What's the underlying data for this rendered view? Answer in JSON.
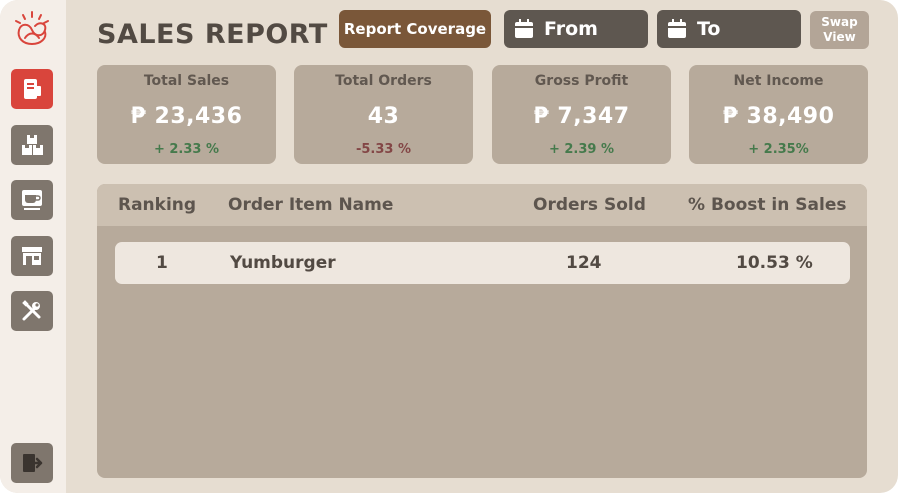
{
  "header": {
    "title": "SALES REPORT",
    "report_coverage_label": "Report Coverage",
    "from_label": "From",
    "to_label": "To",
    "swap_view_line1": "Swap",
    "swap_view_line2": "View"
  },
  "sidebar": {
    "items": [
      {
        "icon": "receipt-icon",
        "active": true
      },
      {
        "icon": "boxes-icon",
        "active": false
      },
      {
        "icon": "coffee-cup-icon",
        "active": false
      },
      {
        "icon": "store-icon",
        "active": false
      },
      {
        "icon": "tools-icon",
        "active": false
      }
    ],
    "logout_icon": "logout-icon",
    "logo_icon": "pretzel-logo-icon"
  },
  "stats": [
    {
      "label": "Total Sales",
      "value": "₱ 23,436",
      "change": "+ 2.33 %",
      "trend": "positive"
    },
    {
      "label": "Total Orders",
      "value": "43",
      "change": "-5.33 %",
      "trend": "negative"
    },
    {
      "label": "Gross Profit",
      "value": "₱ 7,347",
      "change": "+ 2.39 %",
      "trend": "positive"
    },
    {
      "label": "Net Income",
      "value": "₱ 38,490",
      "change": "+ 2.35%",
      "trend": "positive"
    }
  ],
  "table": {
    "columns": [
      "Ranking",
      "Order Item Name",
      "Orders Sold",
      "% Boost in Sales"
    ],
    "rows": [
      [
        "1",
        "Yumburger",
        "124",
        "10.53 %"
      ]
    ]
  },
  "colors": {
    "active_nav": "#d9453c",
    "inactive_nav": "#7f766d",
    "coverage_button": "#7a5739",
    "date_button": "#5e5750",
    "positive": "#457a4c",
    "negative": "#834646"
  }
}
